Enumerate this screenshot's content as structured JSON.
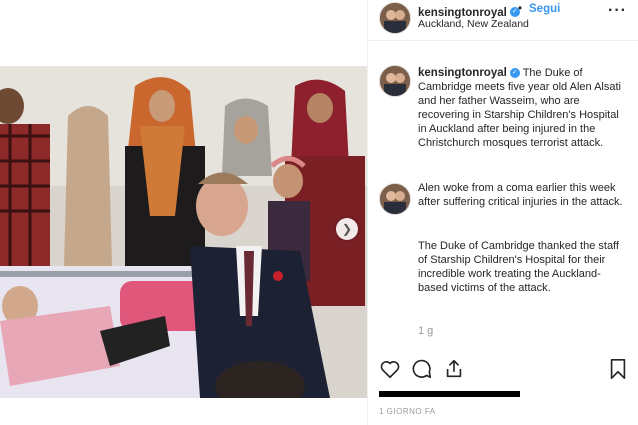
{
  "header": {
    "username": "kensingtonroyal",
    "separator": "•",
    "follow_label": "Segui",
    "location": "Auckland, New Zealand",
    "more_label": "···"
  },
  "caption": {
    "username": "kensingtonroyal",
    "text": "The Duke of Cambridge meets five year old Alen Alsati and her father Wasseim, who are recovering in Starship Children's Hospital in Auckland after being injured in the Christchurch mosques terrorist attack."
  },
  "comments": [
    {
      "text": "Alen woke from a coma earlier this week after suffering critical injuries in the attack."
    },
    {
      "text": "The Duke of Cambridge thanked the staff of Starship Children's Hospital for their incredible work treating the Auckland-based victims of the attack."
    }
  ],
  "comment_time": "1 g",
  "timestamp": "1 GIORNO FA",
  "colors": {
    "link": "#3897f0",
    "text": "#262626",
    "muted": "#999999"
  },
  "icons": [
    "heart-icon",
    "comment-icon",
    "share-icon",
    "bookmark-icon",
    "verified-icon",
    "chevron-right-icon"
  ]
}
